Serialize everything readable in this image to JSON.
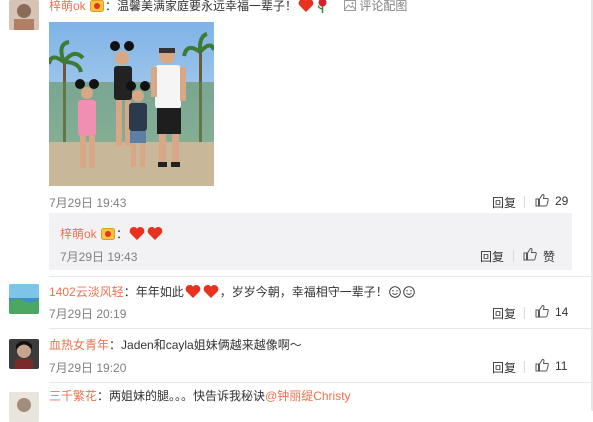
{
  "comments": [
    {
      "username": "梓萌ok",
      "text": "：温馨美满家庭要永远幸福一辈子！",
      "header_link": "评论配图",
      "time": "7月29日 19:43",
      "reply_label": "回复",
      "like_count": "29"
    },
    {
      "username": "梓萌ok",
      "text": "：",
      "time": "7月29日 19:43",
      "reply_label": "回复",
      "like_label": "赞"
    },
    {
      "username": "1402云淡风轻",
      "text_a": "：年年如此",
      "text_b": "，岁岁今朝，幸福相守一辈子！",
      "time": "7月29日 20:19",
      "reply_label": "回复",
      "like_count": "14"
    },
    {
      "username": "血热女青年",
      "text": "：Jaden和cayla姐妹俩越来越像啊～",
      "time": "7月29日 19:20",
      "reply_label": "回复",
      "like_count": "11"
    },
    {
      "username": "三千繁花",
      "text": "：两姐妹的腿。。。快告诉我秘诀",
      "mention": "@钟丽缇Christy"
    }
  ],
  "icons": {
    "like": "thumbs-up-icon",
    "heart": "heart-emoji",
    "badge": "vip-badge-icon",
    "smile": "smile-emoji",
    "rose": "rose-emoji",
    "image": "image-icon"
  },
  "colors": {
    "username": "#eb7350",
    "heart": "#e8321f",
    "reply_bg": "#f2f2f5"
  }
}
